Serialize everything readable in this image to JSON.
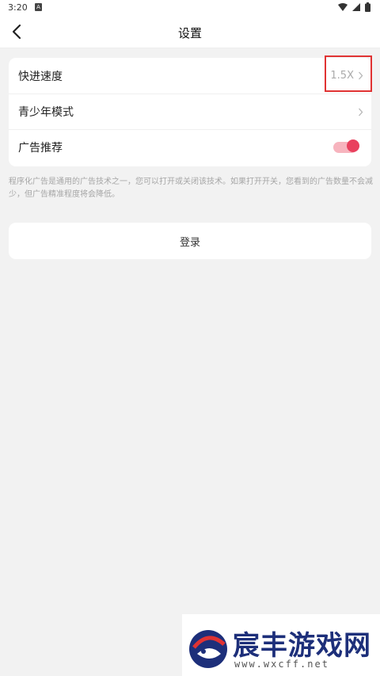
{
  "status_bar": {
    "time": "3:20",
    "notification_badge": "A"
  },
  "header": {
    "title": "设置"
  },
  "settings": {
    "items": [
      {
        "label": "快进速度",
        "value": "1.5X"
      },
      {
        "label": "青少年模式",
        "value": ""
      },
      {
        "label": "广告推荐",
        "toggle_on": true
      }
    ]
  },
  "hint": "程序化广告是通用的广告技术之一，您可以打开或关闭该技术。如果打开开关，您看到的广告数量不会减少，但广告精准程度将会降低。",
  "login": {
    "label": "登录"
  },
  "watermark": {
    "title": "宸丰游戏网",
    "url": "www.wxcff.net"
  },
  "colors": {
    "accent": "#e9415e",
    "toggle_track": "#f7b4be",
    "highlight": "#e03333",
    "watermark_blue": "#1d2f7a"
  },
  "icons": [
    "back-arrow-icon",
    "chevron-right-icon",
    "wifi-icon",
    "signal-icon",
    "battery-icon"
  ]
}
